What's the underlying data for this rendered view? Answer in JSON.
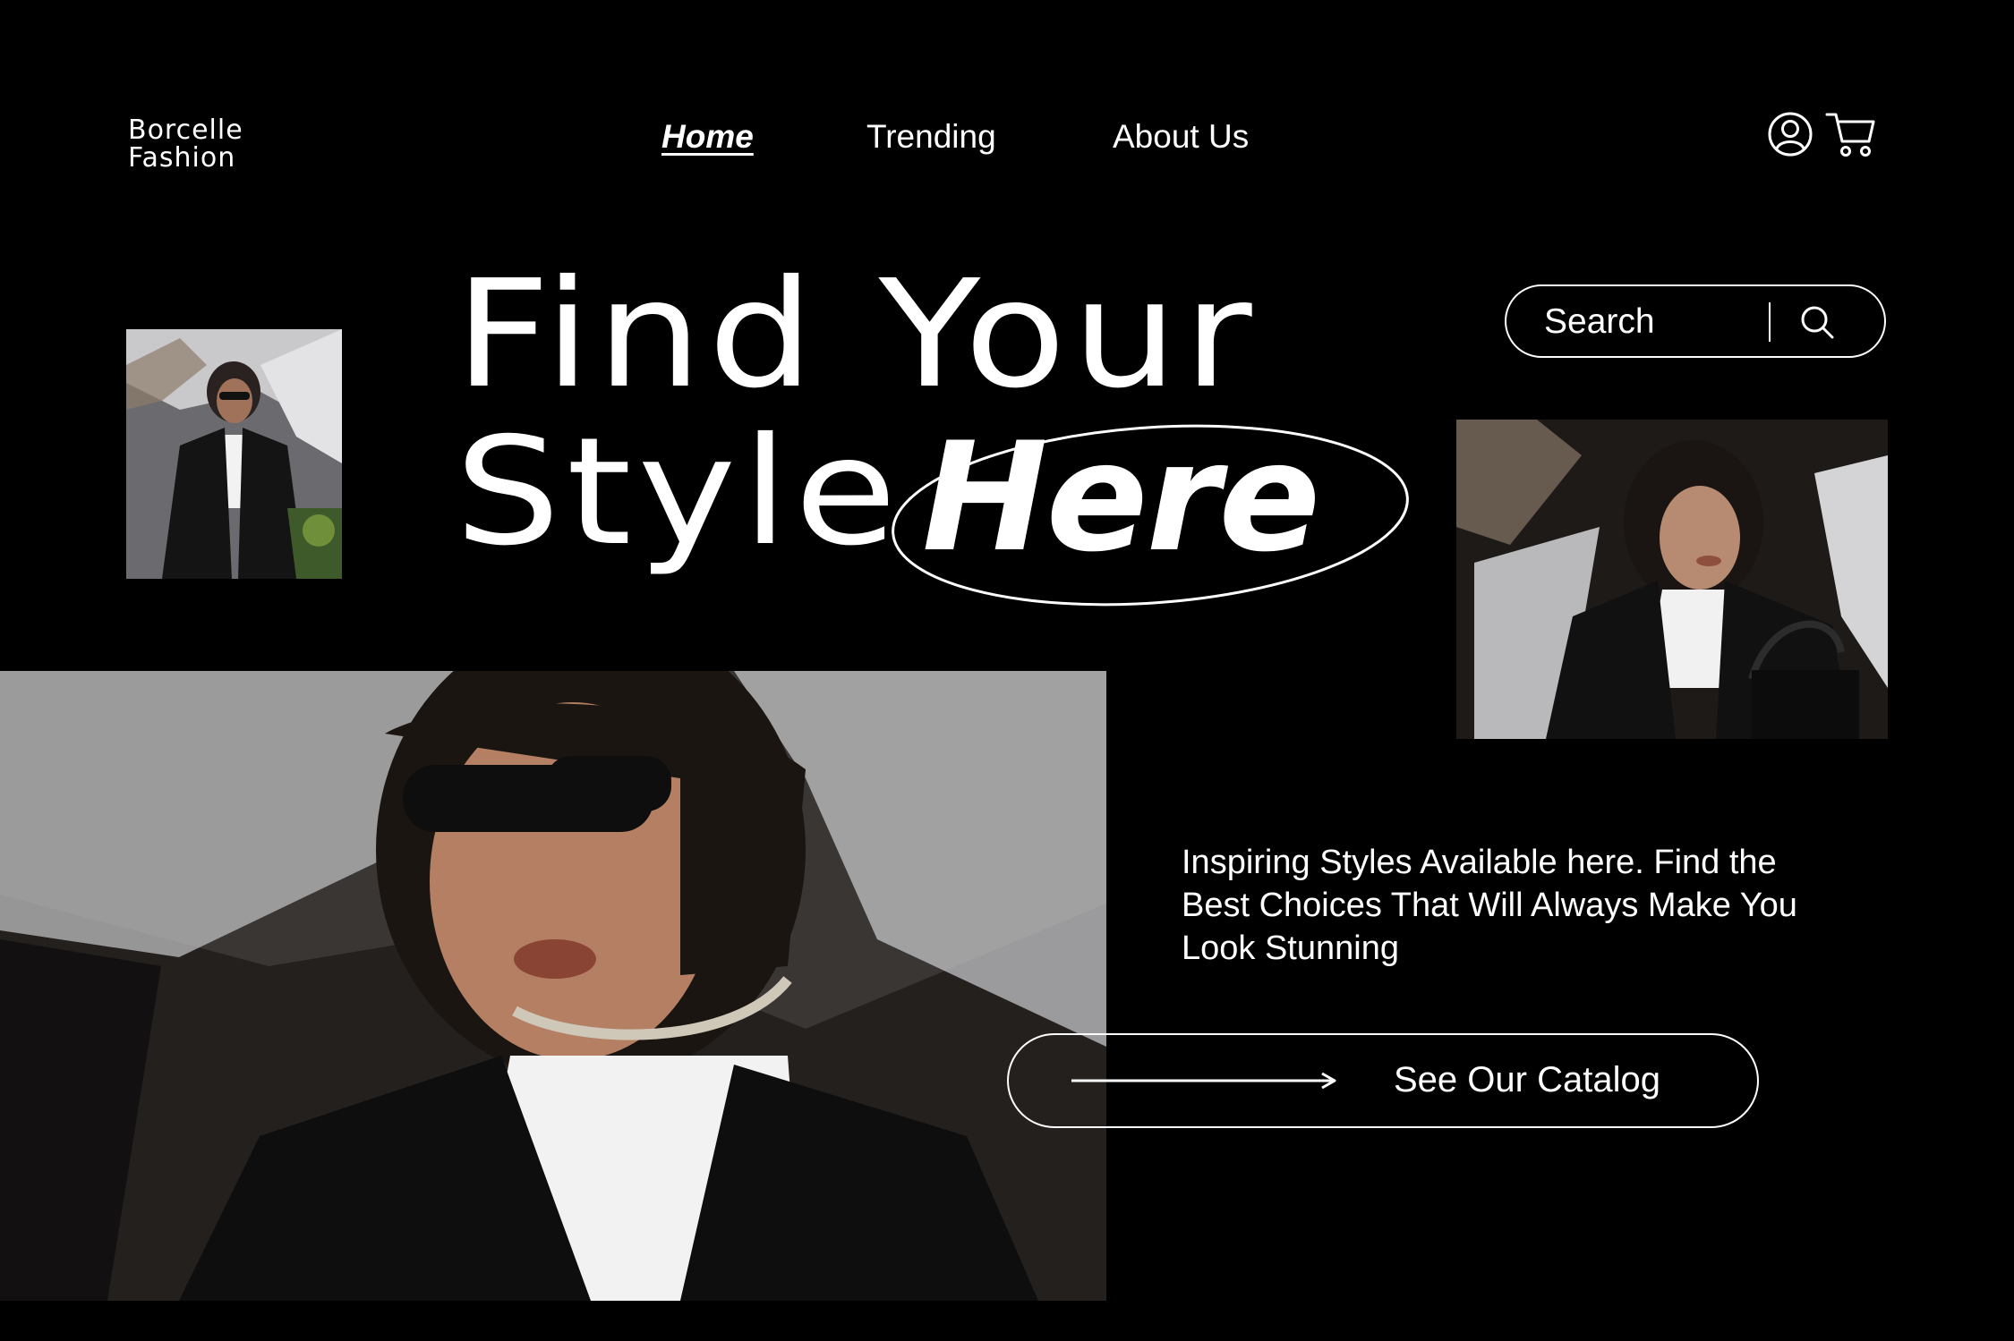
{
  "brand": {
    "line1": "Borcelle",
    "line2": "Fashion"
  },
  "nav": {
    "items": [
      {
        "label": "Home",
        "active": true
      },
      {
        "label": "Trending",
        "active": false
      },
      {
        "label": "About Us",
        "active": false
      }
    ]
  },
  "header_icons": {
    "account": "user-circle-icon",
    "cart": "shopping-cart-icon"
  },
  "hero": {
    "line1": "Find Your",
    "line2": "Style",
    "accent": "Here"
  },
  "search": {
    "placeholder": "Search",
    "icon": "search-icon"
  },
  "tagline": "Inspiring Styles Available here. Find the Best Choices That Will Always Make You Look Stunning",
  "cta": {
    "label": "See Our Catalog",
    "icon": "arrow-right-icon"
  },
  "colors": {
    "background": "#000000",
    "foreground": "#ffffff"
  }
}
